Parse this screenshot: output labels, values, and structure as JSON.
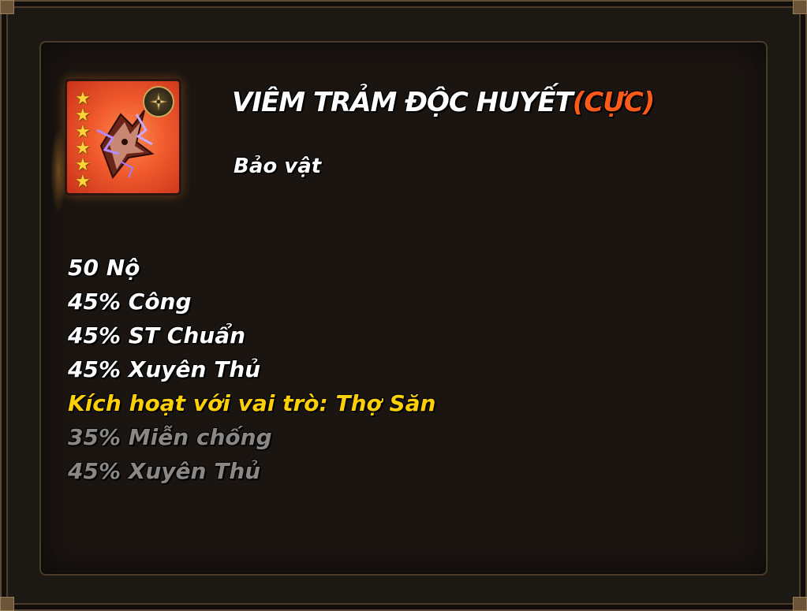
{
  "item": {
    "name": "VIÊM TRẢM ĐỘC HUYẾT",
    "grade": "(CỰC)",
    "type": "Bảo vật",
    "star_count": 6,
    "icon": "winged-weapon-art",
    "class_icon": "shuriken-icon"
  },
  "stats": [
    {
      "text": "50 Nộ",
      "color": "white"
    },
    {
      "text": "45% Công",
      "color": "white"
    },
    {
      "text": "45% ST Chuẩn",
      "color": "white"
    },
    {
      "text": "45% Xuyên Thủ",
      "color": "white"
    },
    {
      "text": "Kích hoạt với vai trò: Thợ Săn",
      "color": "yellow"
    },
    {
      "text": "35% Miễn chống",
      "color": "gray"
    },
    {
      "text": "45% Xuyên Thủ",
      "color": "gray"
    }
  ],
  "colors": {
    "white": "#ffffff",
    "yellow": "#ffd000",
    "gray": "#8a8784",
    "grade": "#ff5a1a"
  }
}
